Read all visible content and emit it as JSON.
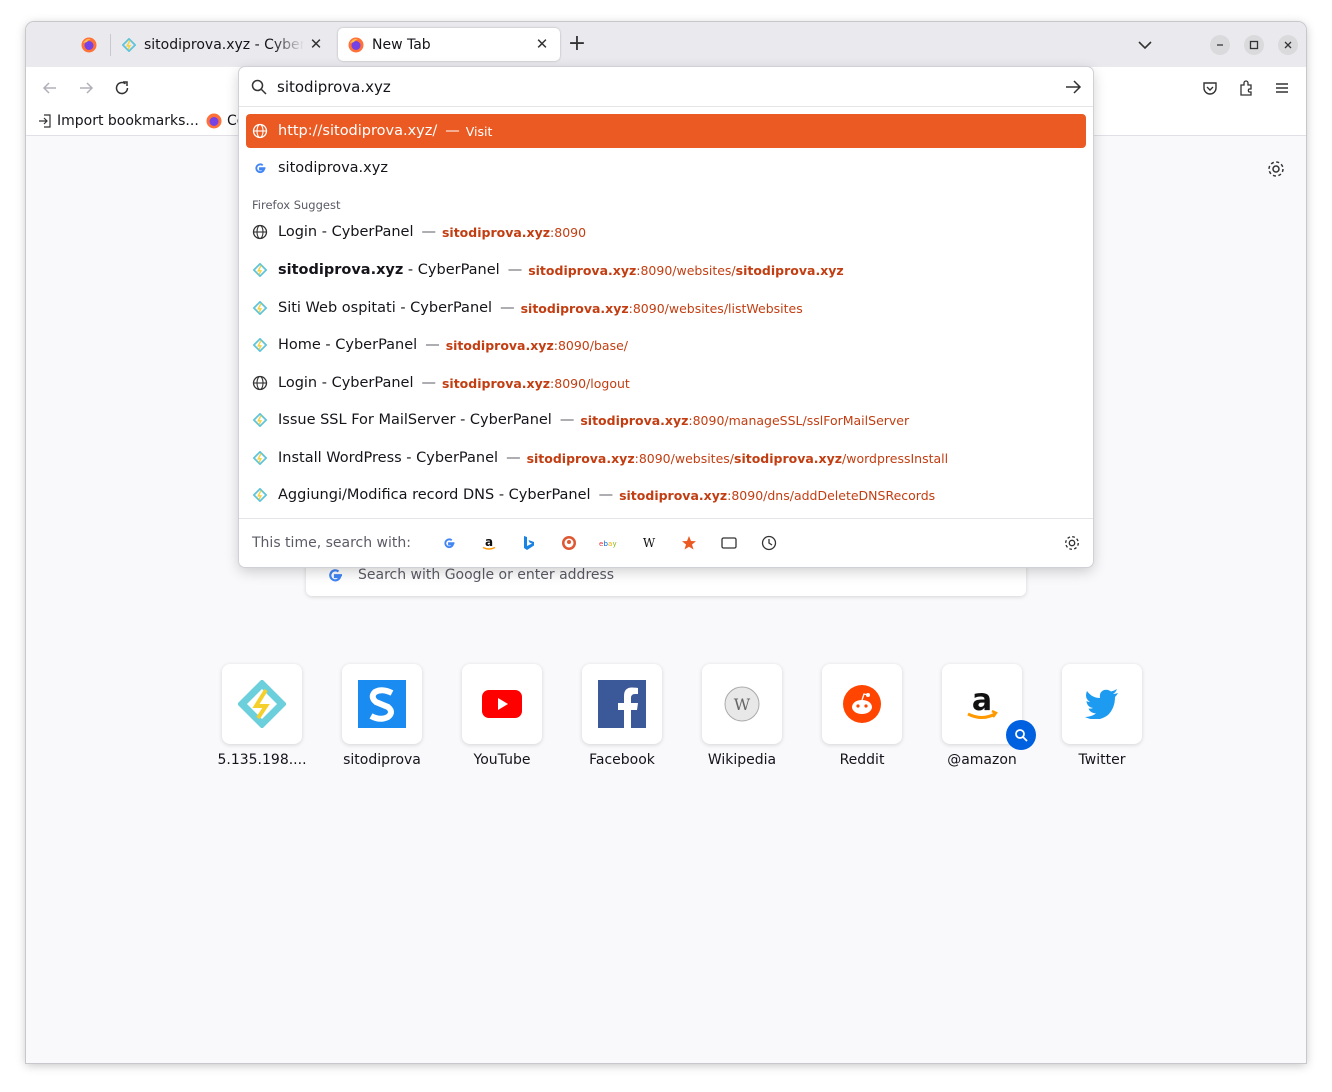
{
  "tabs": [
    {
      "title": "sitodiprova.xyz - CyberPanel"
    },
    {
      "title": "New Tab"
    }
  ],
  "bookmarks": [
    {
      "label": "Import bookmarks..."
    },
    {
      "label": "Co"
    }
  ],
  "urlbar": {
    "value": "sitodiprova.xyz",
    "heuristic": {
      "url": "http://sitodiprova.xyz/",
      "action": "Visit"
    },
    "search_suggestion": "sitodiprova.xyz",
    "group_label": "Firefox Suggest",
    "results": [
      {
        "title": "Login - CyberPanel",
        "domain": "sitodiprova.xyz",
        "path": ":8090",
        "icon": "globe-icon"
      },
      {
        "title_bold": "sitodiprova.xyz",
        "title": " - CyberPanel",
        "domain": "sitodiprova.xyz",
        "path": ":8090/websites/",
        "path_bold": "sitodiprova.xyz",
        "icon": "cyberpanel-icon"
      },
      {
        "title": "Siti Web ospitati - CyberPanel",
        "domain": "sitodiprova.xyz",
        "path": ":8090/websites/listWebsites",
        "icon": "cyberpanel-icon"
      },
      {
        "title": "Home - CyberPanel",
        "domain": "sitodiprova.xyz",
        "path": ":8090/base/",
        "icon": "cyberpanel-icon"
      },
      {
        "title": "Login - CyberPanel",
        "domain": "sitodiprova.xyz",
        "path": ":8090/logout",
        "icon": "globe-icon"
      },
      {
        "title": "Issue SSL For MailServer - CyberPanel",
        "domain": "sitodiprova.xyz",
        "path": ":8090/manageSSL/sslForMailServer",
        "icon": "cyberpanel-icon"
      },
      {
        "title": "Install WordPress - CyberPanel",
        "domain": "sitodiprova.xyz",
        "path": ":8090/websites/",
        "path_bold": "sitodiprova.xyz",
        "path_tail": "/wordpressInstall",
        "icon": "cyberpanel-icon"
      },
      {
        "title": "Aggiungi/Modifica record DNS - CyberPanel",
        "domain": "sitodiprova.xyz",
        "path": ":8090/dns/addDeleteDNSRecords",
        "icon": "cyberpanel-icon"
      }
    ],
    "oneoff_label": "This time, search with:",
    "engines": [
      "google",
      "amazon",
      "bing",
      "duckduckgo",
      "ebay",
      "wikipedia",
      "bookmarks",
      "tabs",
      "history"
    ]
  },
  "newtab": {
    "search_placeholder": "Search with Google or enter address",
    "tiles": [
      {
        "label": "5.135.198....",
        "icon": "cyberpanel-icon"
      },
      {
        "label": "sitodiprova",
        "icon": "s-logo-icon"
      },
      {
        "label": "YouTube",
        "icon": "youtube-icon"
      },
      {
        "label": "Facebook",
        "icon": "facebook-icon"
      },
      {
        "label": "Wikipedia",
        "icon": "wikipedia-icon"
      },
      {
        "label": "Reddit",
        "icon": "reddit-icon"
      },
      {
        "label": "@amazon",
        "icon": "amazon-icon"
      },
      {
        "label": "Twitter",
        "icon": "twitter-icon"
      }
    ]
  },
  "colors": {
    "accent": "#eb5a22",
    "url_highlight": "#c23e12",
    "search_badge": "#0061e0"
  }
}
